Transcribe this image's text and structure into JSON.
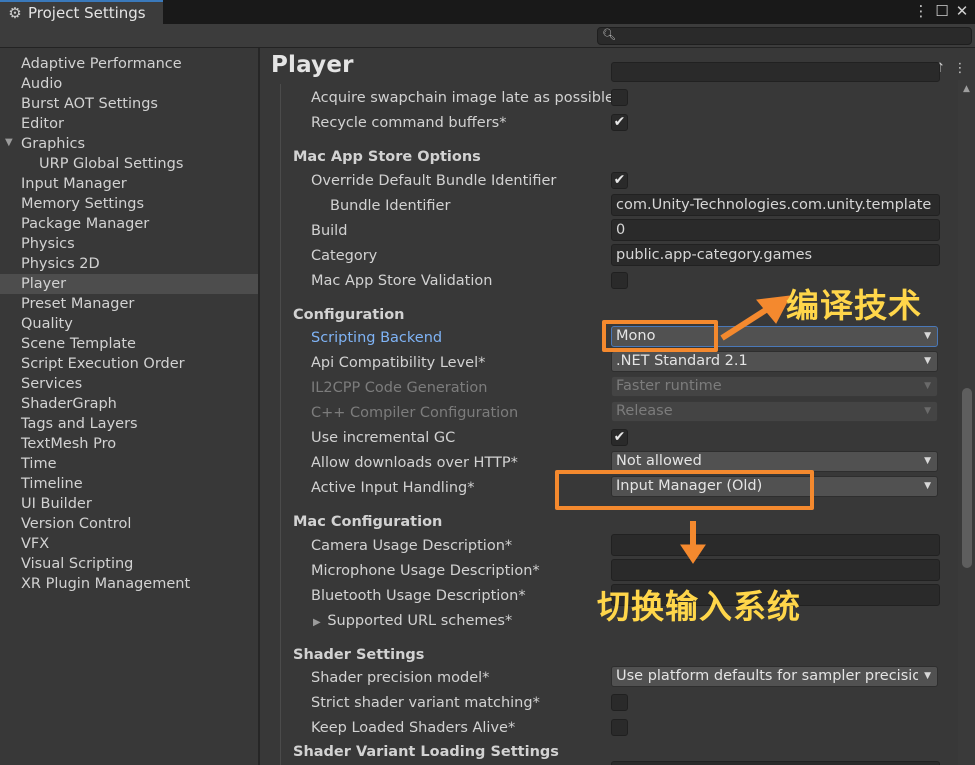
{
  "tab": {
    "title": "Project Settings"
  },
  "sidebar": {
    "items": [
      "Adaptive Performance",
      "Audio",
      "Burst AOT Settings",
      "Editor",
      "Graphics",
      "URP Global Settings",
      "Input Manager",
      "Memory Settings",
      "Package Manager",
      "Physics",
      "Physics 2D",
      "Player",
      "Preset Manager",
      "Quality",
      "Scene Template",
      "Script Execution Order",
      "Services",
      "ShaderGraph",
      "Tags and Layers",
      "TextMesh Pro",
      "Time",
      "Timeline",
      "UI Builder",
      "Version Control",
      "VFX",
      "Visual Scripting",
      "XR Plugin Management"
    ],
    "selected": "Player"
  },
  "main": {
    "title": "Player",
    "rows": {
      "acquire_swapchain": {
        "label": "Acquire swapchain image late as possible",
        "checked": false
      },
      "recycle_buffers": {
        "label": "Recycle command buffers*",
        "checked": true
      },
      "mac_store_header": "Mac App Store Options",
      "override_bundle": {
        "label": "Override Default Bundle Identifier",
        "checked": true
      },
      "bundle_id": {
        "label": "Bundle Identifier",
        "value": "com.Unity-Technologies.com.unity.template"
      },
      "build": {
        "label": "Build",
        "value": "0"
      },
      "category": {
        "label": "Category",
        "value": "public.app-category.games"
      },
      "store_validation": {
        "label": "Mac App Store Validation",
        "checked": false
      },
      "configuration_header": "Configuration",
      "scripting_backend": {
        "label": "Scripting Backend",
        "value": "Mono"
      },
      "api_level": {
        "label": "Api Compatibility Level*",
        "value": ".NET Standard 2.1"
      },
      "il2cpp_gen": {
        "label": "IL2CPP Code Generation",
        "value": "Faster runtime"
      },
      "cpp_config": {
        "label": "C++ Compiler Configuration",
        "value": "Release"
      },
      "incremental_gc": {
        "label": "Use incremental GC",
        "checked": true
      },
      "http_downloads": {
        "label": "Allow downloads over HTTP*",
        "value": "Not allowed"
      },
      "input_handling": {
        "label": "Active Input Handling*",
        "value": "Input Manager (Old)"
      },
      "mac_config_header": "Mac Configuration",
      "camera_usage": {
        "label": "Camera Usage Description*",
        "value": ""
      },
      "mic_usage": {
        "label": "Microphone Usage Description*",
        "value": ""
      },
      "bluetooth_usage": {
        "label": "Bluetooth Usage Description*",
        "value": ""
      },
      "url_schemes": {
        "label": "Supported URL schemes*"
      },
      "shader_settings_header": "Shader Settings",
      "shader_precision": {
        "label": "Shader precision model*",
        "value": "Use platform defaults for sampler precision"
      },
      "strict_shader": {
        "label": "Strict shader variant matching*",
        "checked": false
      },
      "keep_shaders": {
        "label": "Keep Loaded Shaders Alive*",
        "checked": false
      },
      "shader_variant_header": "Shader Variant Loading Settings"
    }
  },
  "annotations": {
    "compile_tech": "编译技术",
    "switch_input": "切换输入系统",
    "color": "#f4892e",
    "text_color": "#ffd64a"
  },
  "icons": [
    "gear-icon",
    "kebab-menu-icon",
    "maximize-icon",
    "close-icon",
    "search-icon",
    "help-icon",
    "preset-icon",
    "context-menu-icon",
    "triangle-down-icon",
    "triangle-right-icon",
    "checkmark-icon"
  ]
}
